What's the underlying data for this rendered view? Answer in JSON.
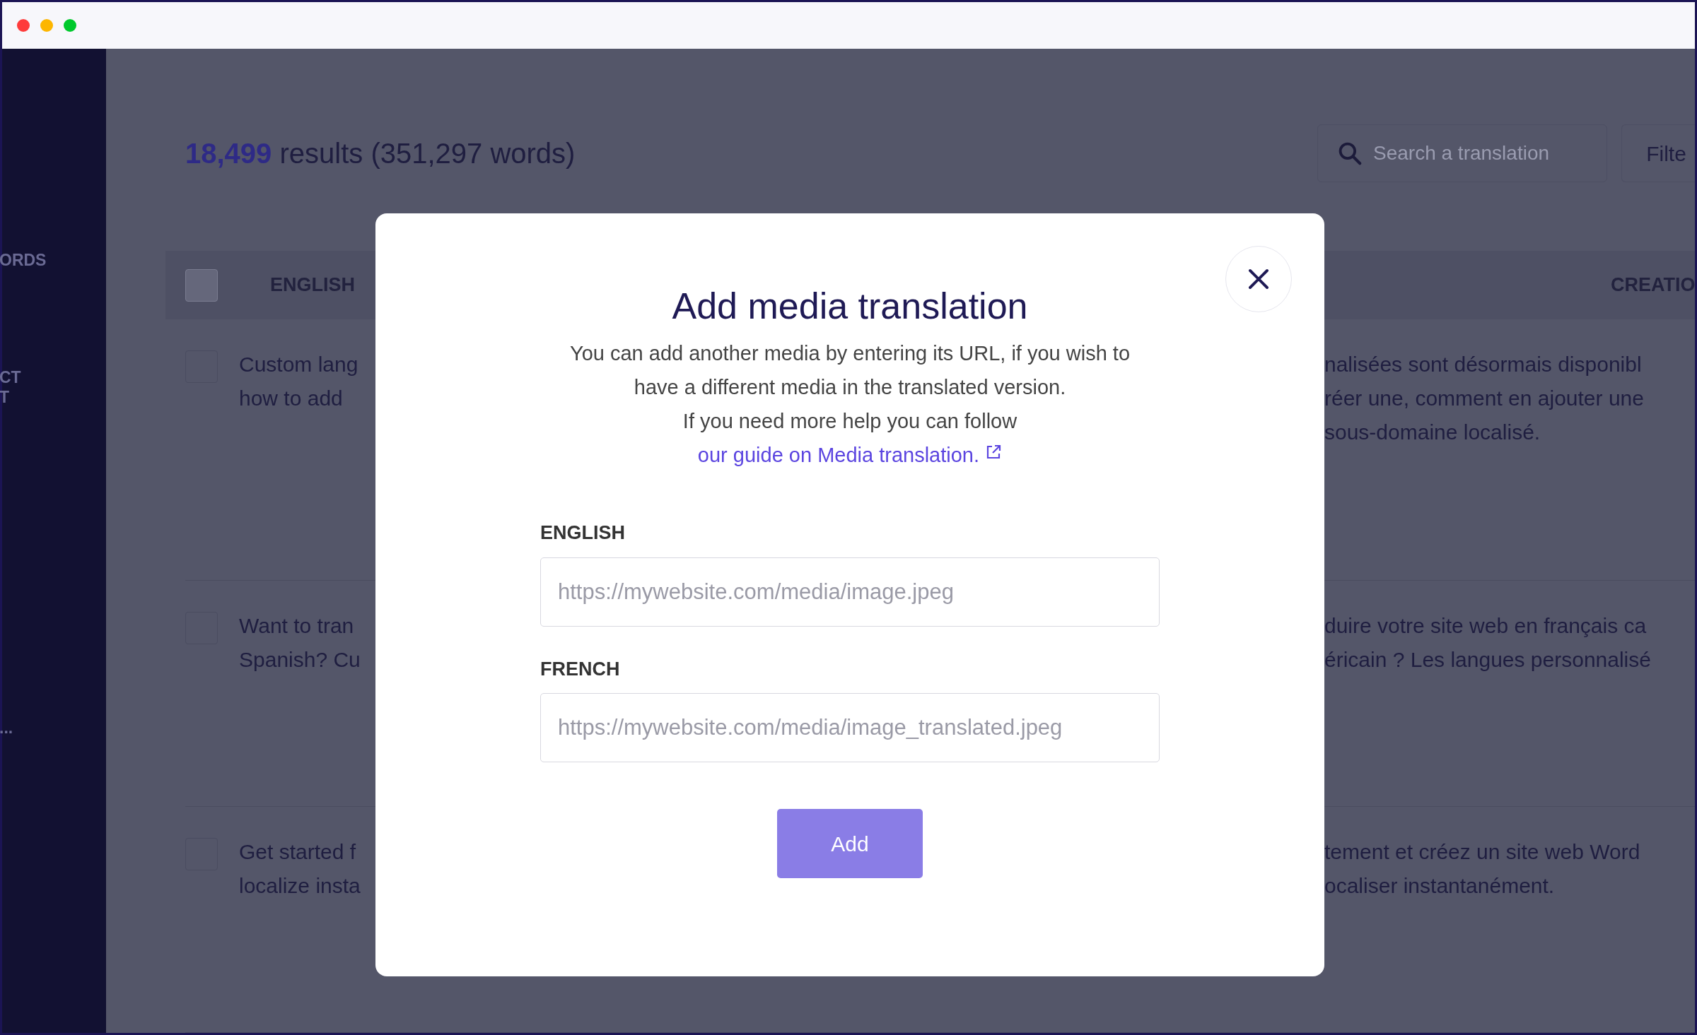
{
  "sidebar": {
    "items": [
      "ORDS",
      "CT",
      "T",
      "..."
    ]
  },
  "results": {
    "count": "18,499",
    "label": "results (351,297 words)"
  },
  "search": {
    "placeholder": "Search a translation"
  },
  "filter_button": "Filte",
  "table": {
    "select_all_checked": false,
    "columns": [
      "ENGLISH",
      "CREATIO"
    ],
    "rows": [
      {
        "checked": false,
        "source_lines": [
          "Custom lang",
          "how to add"
        ],
        "translation_lines": [
          "nalisées sont désormais disponibl",
          "réer une, comment en ajouter une",
          "sous-domaine localisé."
        ]
      },
      {
        "checked": false,
        "source_lines": [
          "Want to tran",
          "Spanish? Cu"
        ],
        "translation_lines": [
          "duire votre site web en français ca",
          "éricain ? Les langues personnalisé"
        ]
      },
      {
        "checked": false,
        "source_lines": [
          "Get started f",
          "localize insta"
        ],
        "translation_lines": [
          "tement et créez un site web Word",
          "ocaliser instantanément."
        ]
      }
    ]
  },
  "modal": {
    "title": "Add media translation",
    "description": "You can add another media by entering its URL, if you wish to have a different media in the translated version.",
    "help_text": "If you need more help you can follow",
    "help_link": "our guide on Media translation.",
    "fields": [
      {
        "label": "ENGLISH",
        "placeholder": "https://mywebsite.com/media/image.jpeg"
      },
      {
        "label": "FRENCH",
        "placeholder": "https://mywebsite.com/media/image_translated.jpeg"
      }
    ],
    "submit": "Add"
  }
}
